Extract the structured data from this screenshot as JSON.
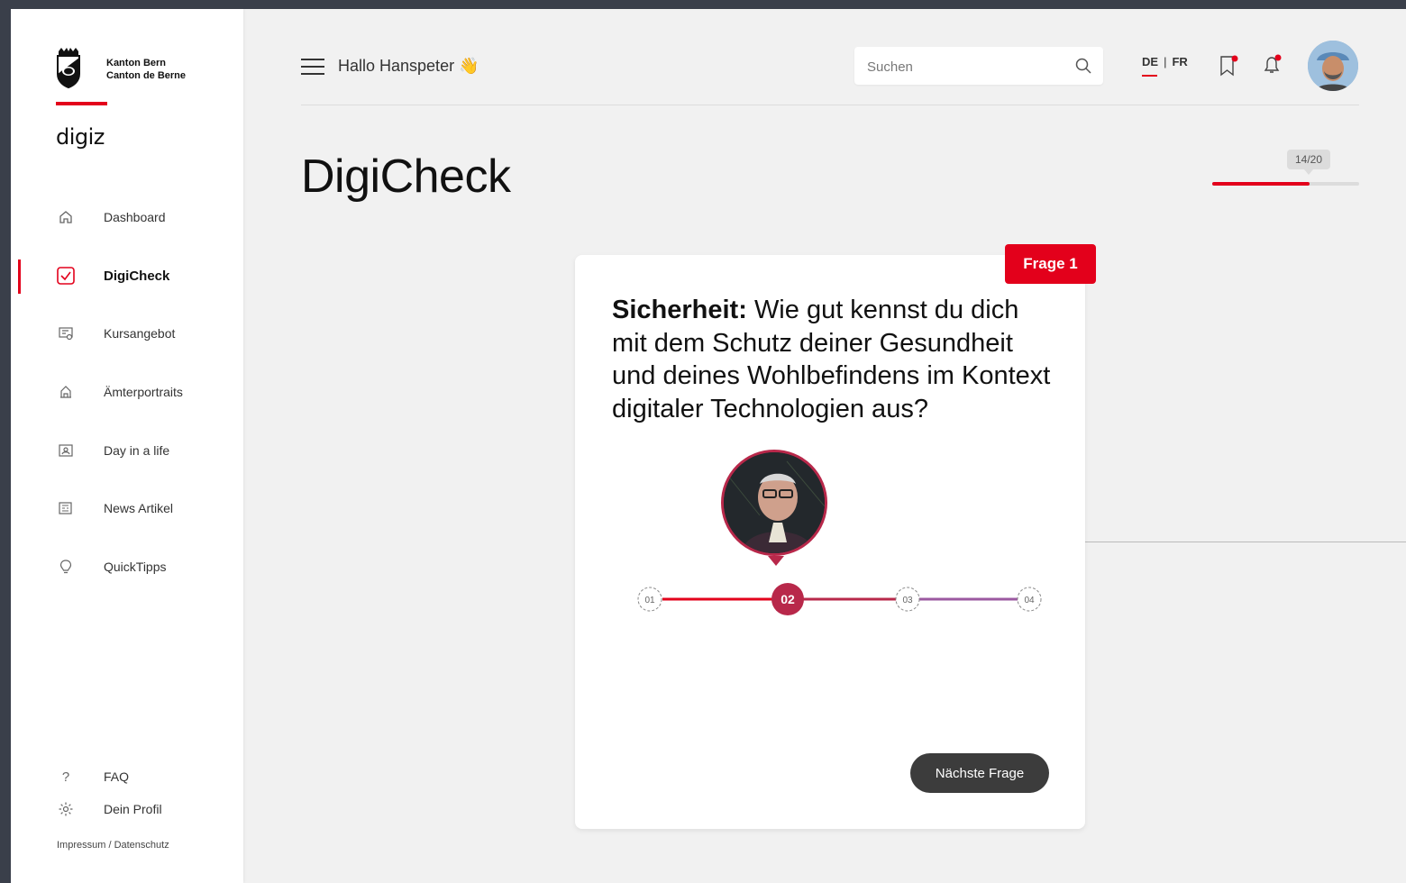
{
  "sidebar": {
    "brand_line1": "Kanton Bern",
    "brand_line2": "Canton de Berne",
    "app_name": "digiz",
    "items": [
      {
        "label": "Dashboard",
        "icon": "home-icon"
      },
      {
        "label": "DigiCheck",
        "icon": "checkbox-icon",
        "active": true
      },
      {
        "label": "Kursangebot",
        "icon": "course-icon"
      },
      {
        "label": "Ämterportraits",
        "icon": "building-icon"
      },
      {
        "label": "Day in a life",
        "icon": "id-card-icon"
      },
      {
        "label": "News Artikel",
        "icon": "news-icon"
      },
      {
        "label": "QuickTipps",
        "icon": "lightbulb-icon"
      }
    ],
    "footer": {
      "faq": "FAQ",
      "profile": "Dein Profil",
      "legal": "Impressum / Datenschutz"
    }
  },
  "header": {
    "greeting": "Hallo Hanspeter 👋",
    "search_placeholder": "Suchen",
    "lang_de": "DE",
    "lang_sep": "|",
    "lang_fr": "FR",
    "active_lang": "DE"
  },
  "page": {
    "title": "DigiCheck",
    "progress_label": "14/20",
    "progress_fraction": 0.66
  },
  "card": {
    "badge": "Frage 1",
    "topic": "Sicherheit:",
    "question": "Wie gut kennst du dich mit dem Schutz deiner Gesundheit und deines Wohlbefindens im Kontext digitaler Technologien aus?",
    "scale": [
      "01",
      "02",
      "03",
      "04"
    ],
    "selected": "02",
    "next_label": "Nächste Frage"
  },
  "colors": {
    "accent": "#e3001b",
    "selected": "#b8284a",
    "purple": "#9b59a0"
  }
}
